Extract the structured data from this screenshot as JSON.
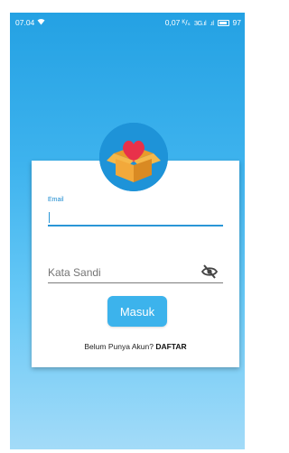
{
  "status_bar": {
    "time": "07.04",
    "data_speed": "0,07 ᴷ/ₛ",
    "signal_1": "3G",
    "battery_level": "97"
  },
  "login": {
    "email_label": "Email",
    "email_value": "",
    "password_placeholder": "Kata Sandi",
    "login_button": "Masuk",
    "register_prompt": "Belum Punya Akun?",
    "register_link": "DAFTAR"
  },
  "icons": {
    "app_logo": "heart-box-icon",
    "password_toggle": "eye-off-icon",
    "status_notification": "wifi-icon"
  },
  "colors": {
    "gradient_top": "#24a1e3",
    "gradient_bottom": "#a3dbf8",
    "accent": "#2a96d6",
    "button": "#3cb3ec",
    "logo_circle": "#1e93d8"
  }
}
